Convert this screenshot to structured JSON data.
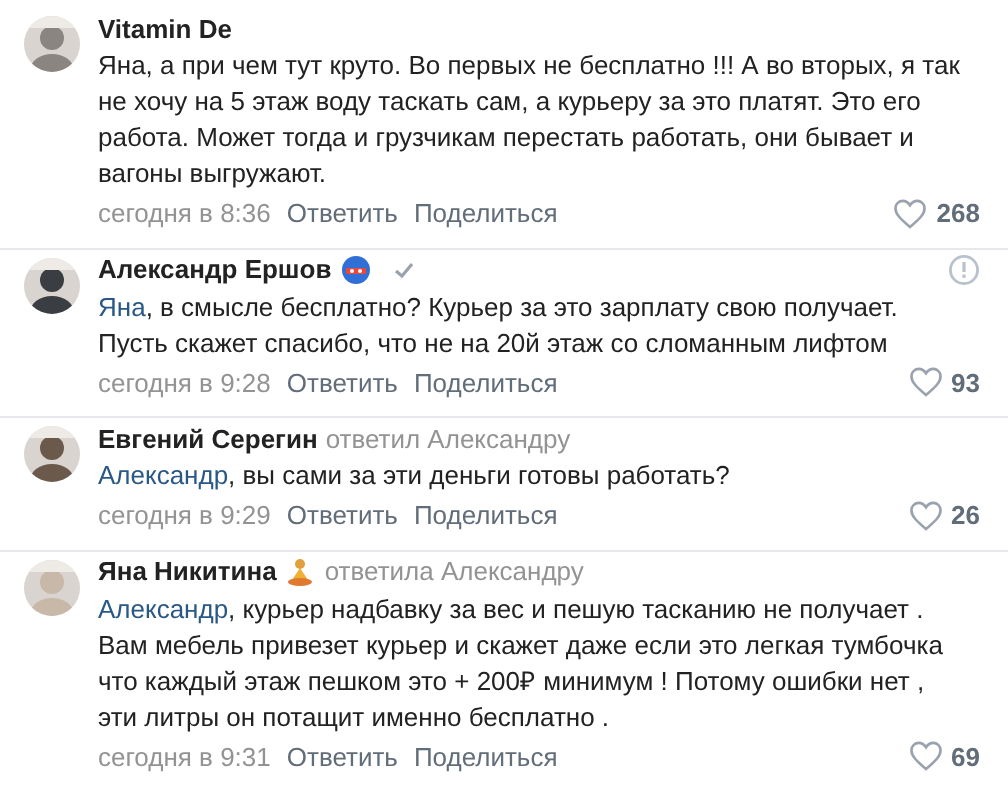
{
  "comments": [
    {
      "author": "Vitamin De",
      "text": "Яна, а при чем тут круто. Во первых не бесплатно !!! А во вторых, я так не хочу на 5 этаж воду таскать сам, а курьеру за это платят. Это его работа. Может тогда и грузчикам перестать работать, они бывает и вагоны выгружают.",
      "time": "сегодня в 8:36",
      "reply": "Ответить",
      "share": "Поделиться",
      "likes": "268"
    },
    {
      "author": "Александр Ершов",
      "badge": {
        "kind": "mask"
      },
      "verified": true,
      "mention": "Яна",
      "text": ", в смысле бесплатно? Курьер за это зарплату свою получает. Пусть скажет спасибо, что не на 20й этаж со сломанным лифтом",
      "time": "сегодня в 9:28",
      "reply": "Ответить",
      "share": "Поделиться",
      "likes": "93",
      "report": true
    },
    {
      "author": "Евгений Серегин",
      "reply_note": "ответил Александру",
      "mention": "Александр",
      "text": ", вы сами за эти деньги готовы работать?",
      "time": "сегодня в 9:29",
      "reply": "Ответить",
      "share": "Поделиться",
      "likes": "26"
    },
    {
      "author": "Яна Никитина",
      "badge": {
        "kind": "lotus"
      },
      "reply_note": "ответила Александру",
      "mention": "Александр",
      "text": ", курьер надбавку за вес и пешую тасканию не получает . Вам мебель привезет курьер и скажет даже если это легкая тумбочка что каждый этаж пешком это + 200₽ минимум ! Потому ошибки нет , эти литры он потащит именно бесплатно .",
      "time": "сегодня в 9:31",
      "reply": "Ответить",
      "share": "Поделиться",
      "likes": "69"
    }
  ]
}
